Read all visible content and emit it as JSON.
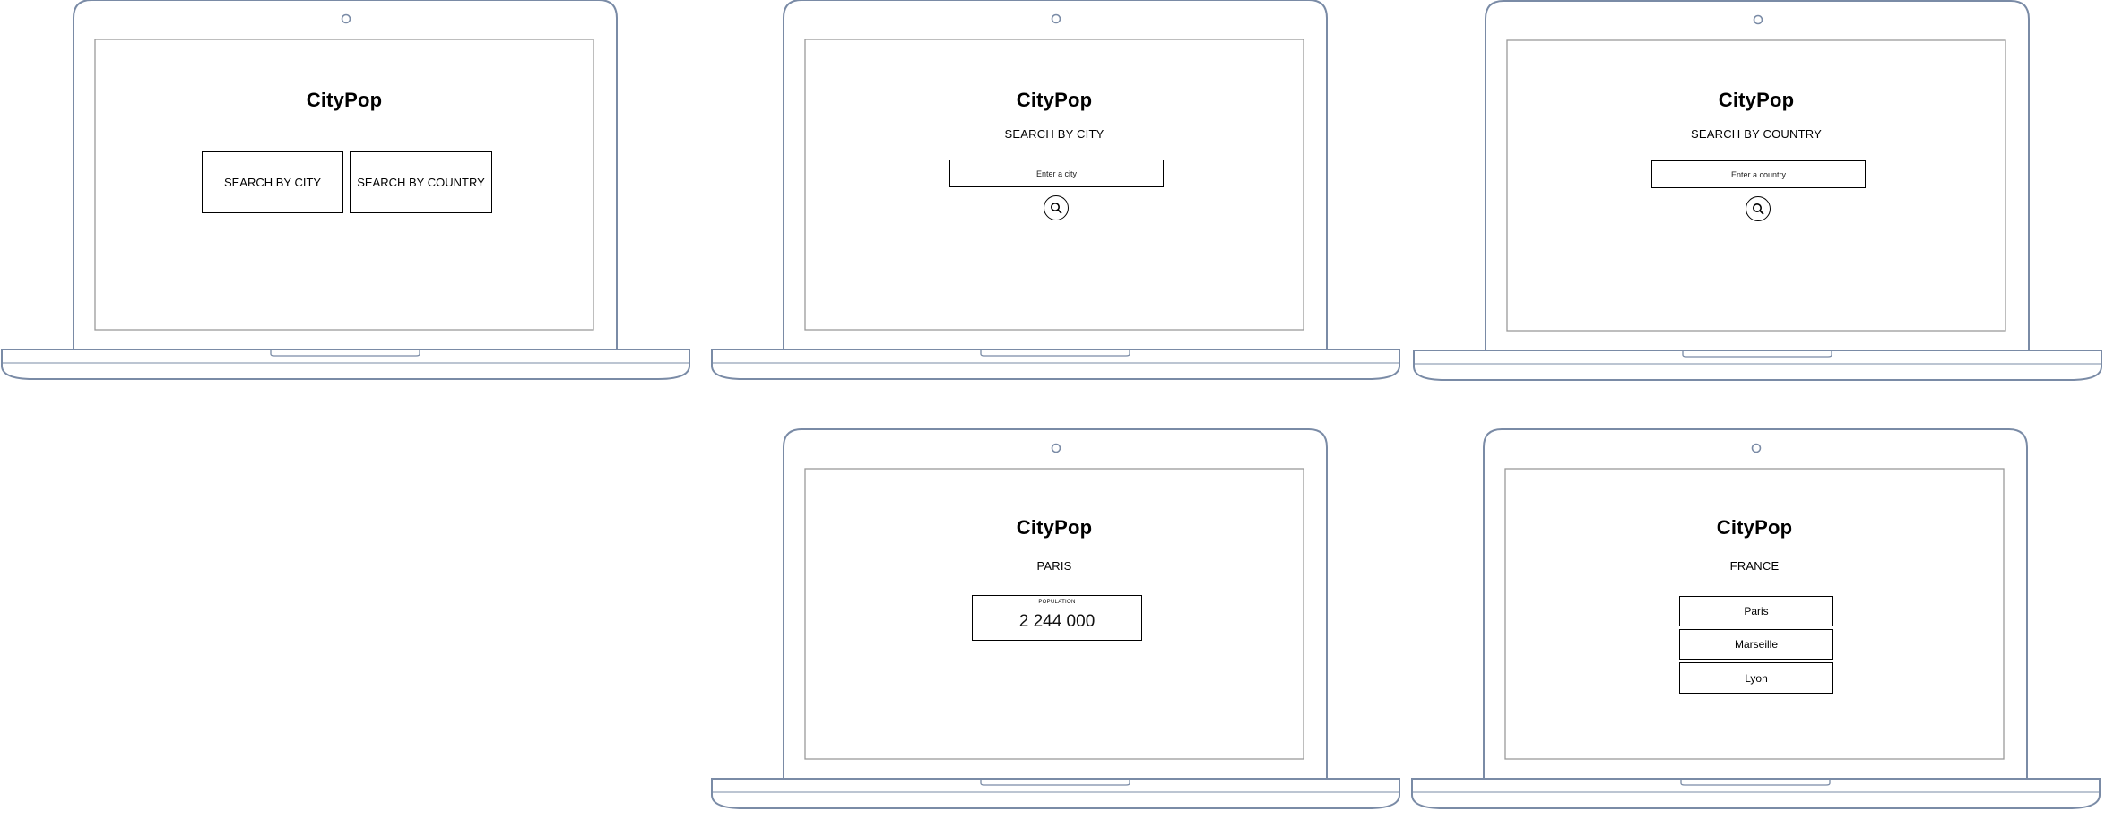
{
  "app_name": "CityPop",
  "screens": {
    "home": {
      "title": "CityPop",
      "search_by_city_button": "SEARCH BY CITY",
      "search_by_country_button": "SEARCH BY COUNTRY"
    },
    "city_search": {
      "title": "CityPop",
      "heading": "SEARCH BY CITY",
      "input_placeholder": "Enter a city",
      "search_icon": "magnifier-icon"
    },
    "country_search": {
      "title": "CityPop",
      "heading": "SEARCH BY COUNTRY",
      "input_placeholder": "Enter a country",
      "search_icon": "magnifier-icon"
    },
    "city_result": {
      "title": "CityPop",
      "city": "PARIS",
      "population_label": "POPULATION",
      "population_value": "2 244 000"
    },
    "country_result": {
      "title": "CityPop",
      "country": "FRANCE",
      "cities": [
        "Paris",
        "Marseille",
        "Lyon"
      ]
    }
  },
  "colors": {
    "laptop_outline": "#7a8ba6",
    "screen_border": "#9a9a9a",
    "text": "#000000"
  }
}
